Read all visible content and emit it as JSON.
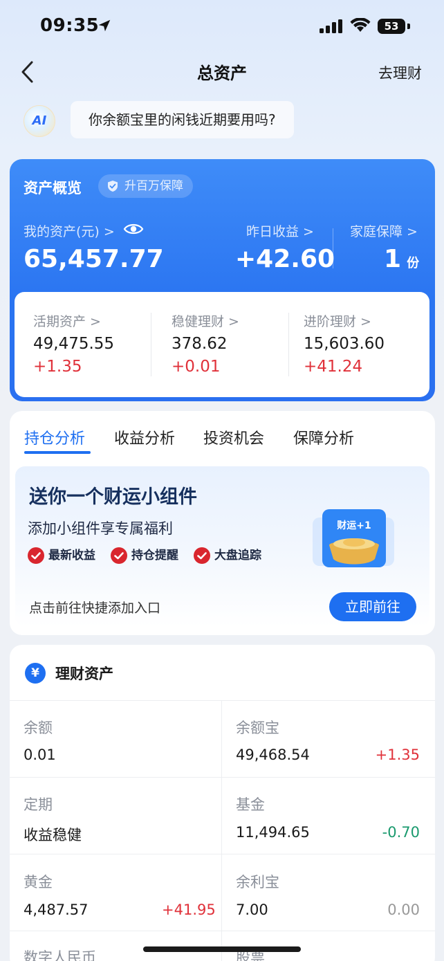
{
  "status_bar": {
    "time": "09:35",
    "battery": "53"
  },
  "nav": {
    "title": "总资产",
    "right_action": "去理财"
  },
  "ai_prompt": {
    "avatar_text": "AI",
    "text": "你余额宝里的闲钱近期要用吗?"
  },
  "overview": {
    "title": "资产概览",
    "badge": "升百万保障",
    "my_assets_label": "我的资产(元) >",
    "my_assets_value": "65,457.77",
    "yesterday_label": "昨日收益 >",
    "yesterday_value": "+42.60",
    "family_label": "家庭保障 >",
    "family_value": "1",
    "family_unit": "份",
    "breakdown": [
      {
        "label": "活期资产 >",
        "value": "49,475.55",
        "change": "+1.35"
      },
      {
        "label": "稳健理财 >",
        "value": "378.62",
        "change": "+0.01"
      },
      {
        "label": "进阶理财 >",
        "value": "15,603.60",
        "change": "+41.24"
      }
    ]
  },
  "tabs": [
    {
      "label": "持仓分析",
      "active": true
    },
    {
      "label": "收益分析",
      "active": false
    },
    {
      "label": "投资机会",
      "active": false
    },
    {
      "label": "保障分析",
      "active": false
    }
  ],
  "widget": {
    "title": "送你一个财运小组件",
    "subtitle": "添加小组件享专属福利",
    "benefits": [
      "最新收益",
      "持仓提醒",
      "大盘追踪"
    ],
    "badge_text": "财运+1",
    "hint": "点击前往快捷添加入口",
    "button": "立即前往"
  },
  "assets": {
    "title": "理财资产",
    "yen_symbol": "¥",
    "rows": [
      [
        {
          "label": "余额",
          "value": "0.01",
          "change": ""
        },
        {
          "label": "余额宝",
          "value": "49,468.54",
          "change": "+1.35"
        }
      ],
      [
        {
          "label": "定期",
          "value": "收益稳健",
          "change": ""
        },
        {
          "label": "基金",
          "value": "11,494.65",
          "change": "-0.70"
        }
      ],
      [
        {
          "label": "黄金",
          "value": "4,487.57",
          "change": "+41.95"
        },
        {
          "label": "余利宝",
          "value": "7.00",
          "change": "0.00"
        }
      ],
      [
        {
          "label": "数字人民币",
          "value": "",
          "change": ""
        },
        {
          "label": "股票",
          "value": "",
          "change": ""
        }
      ]
    ]
  },
  "colors": {
    "accent": "#1e6ff1",
    "card_blue": "#2a74f1",
    "up": "#e0313a",
    "down": "#1a9a6e"
  }
}
